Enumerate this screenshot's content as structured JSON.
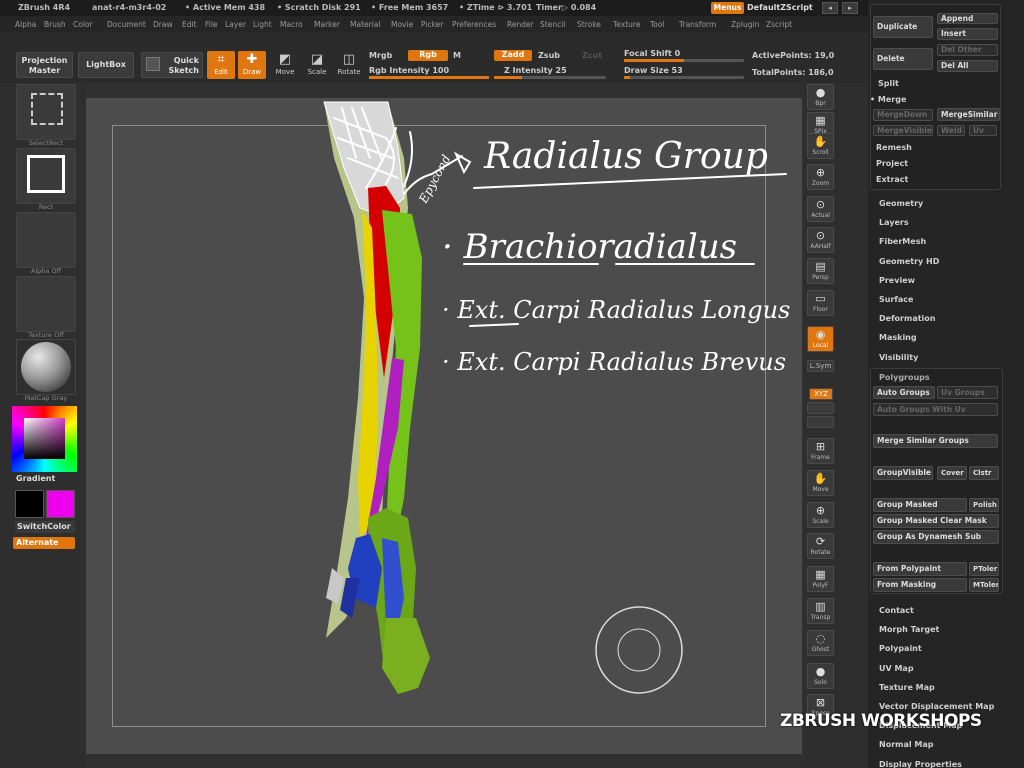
{
  "titlebar": {
    "app": "ZBrush 4R4",
    "file": "anat-r4-m3r4-02",
    "active_mem": "• Active Mem 438",
    "scratch": "• Scratch Disk 291",
    "free_mem": "• Free Mem 3657",
    "ztime": "• ZTime ⊳ 3.701",
    "timer": "Timer▷ 0.084",
    "menus": "Menus",
    "default_zscript": "DefaultZScript"
  },
  "menu": [
    "Alpha",
    "Brush",
    "Color",
    "Document",
    "Draw",
    "Edit",
    "File",
    "Layer",
    "Light",
    "Macro",
    "Marker",
    "Material",
    "Movie",
    "Picker",
    "Preferences",
    "Render",
    "Stencil",
    "Stroke",
    "Texture",
    "Tool",
    "Transform",
    "Zplugin",
    "Zscript"
  ],
  "toolbar": {
    "projection_master": "Projection Master",
    "lightbox": "LightBox",
    "quick_sketch": "Quick Sketch",
    "edit": "Edit",
    "draw": "Draw",
    "move": "Move",
    "scale": "Scale",
    "rotate": "Rotate",
    "mrgb": "Mrgb",
    "rgb": "Rgb",
    "m": "M",
    "rgb_intensity": "Rgb Intensity 100",
    "zadd": "Zadd",
    "zsub": "Zsub",
    "zcut": "Zcut",
    "z_intensity": "Z Intensity 25",
    "focal_shift": "Focal Shift 0",
    "draw_size": "Draw Size 53",
    "active_points": "ActivePoints: 19,0",
    "total_points": "TotalPoints: 186,0",
    "rgb_intensity_value": 1.0,
    "z_intensity_value": 0.25,
    "focal_value": 0.5,
    "draw_size_value": 0.05
  },
  "left": {
    "selectrect": "SelectRect",
    "rect": "Rect",
    "alpha_off": "Alpha Off",
    "texture_off": "Texture Off",
    "matcap": "MatCap Gray",
    "gradient": "Gradient",
    "switchcolor": "SwitchColor",
    "alternate": "Alternate",
    "main_color": "#000000",
    "secondary_color": "#ee00ee"
  },
  "right_shelf": [
    "Bpr",
    "SPix",
    "Scroll",
    "Zoom",
    "Actual",
    "AAHalf",
    "Persp",
    "Floor",
    "Local",
    "L.Sym",
    "XYZ",
    "",
    "",
    "Frame",
    "Move",
    "Scale",
    "Rotate",
    "PolyF",
    "Transp",
    "Ghost",
    "Solo",
    "Xpose"
  ],
  "panel": {
    "duplicate": "Duplicate",
    "append": "Append",
    "insert": "Insert",
    "delete": "Delete",
    "del_other": "Del Other",
    "del_all": "Del All",
    "split": "Split",
    "merge": "Merge",
    "merge_down": "MergeDown",
    "merge_similar": "MergeSimilar",
    "merge_visible": "MergeVisible",
    "weld": "Weld",
    "uv": "Uv",
    "remesh": "Remesh",
    "project": "Project",
    "extract": "Extract",
    "sections": [
      "Geometry",
      "Layers",
      "FiberMesh",
      "Geometry HD",
      "Preview",
      "Surface",
      "Deformation",
      "Masking",
      "Visibility"
    ],
    "polygroups": "Polygroups",
    "auto_groups": "Auto Groups",
    "uv_groups": "Uv Groups",
    "auto_groups_uv": "Auto Groups With Uv",
    "merge_similar_groups": "Merge Similar Groups",
    "group_visible": "GroupVisible",
    "coverage": "Cover",
    "clstr": "Clstr",
    "group_masked": "Group Masked",
    "polish": "Polish",
    "group_masked_clear": "Group Masked Clear Mask",
    "group_dynamesh": "Group As Dynamesh Sub",
    "from_polypaint": "From Polypaint",
    "ptoler": "PToler",
    "from_masking": "From Masking",
    "mtoler": "MToler",
    "sections2": [
      "Contact",
      "Morph Target",
      "Polypaint",
      "UV Map",
      "Texture Map",
      "Vector Displacement Map",
      "Displacement Map",
      "Normal Map",
      "Display Properties"
    ]
  },
  "watermark": "ZBRUSH WORKSHOPS",
  "annotations": {
    "title": "Radialus Group",
    "line1": "· Brachioradialus",
    "line2": "· Ext. Carpi Radialus Longus",
    "line3": "· Ext. Carpi Radialus Brevus",
    "side": "Epycond"
  }
}
